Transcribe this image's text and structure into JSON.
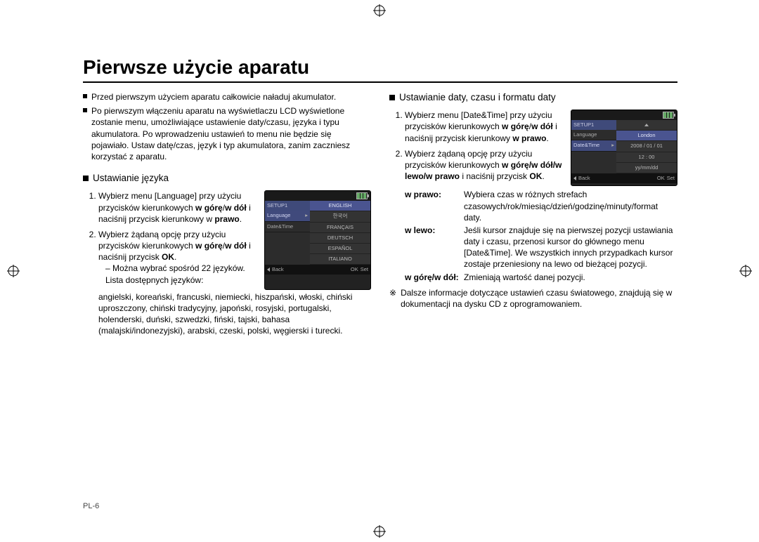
{
  "page_number": "PL-6",
  "title": "Pierwsze użycie aparatu",
  "intro_bullets": [
    "Przed pierwszym użyciem aparatu całkowicie naładuj akumulator.",
    "Po pierwszym włączeniu aparatu na wyświetlaczu LCD wyświetlone zostanie menu, umożliwiające ustawienie daty/czasu, języka i typu akumulatora. Po wprowadzeniu ustawień to menu nie będzie się pojawiało. Ustaw datę/czas, język i typ akumulatora, zanim zaczniesz korzystać z aparatu."
  ],
  "section_language": {
    "heading": "Ustawianie języka",
    "steps": [
      {
        "pre": "Wybierz menu [Language] przy użyciu przycisków kierunkowych ",
        "bold1": "w górę",
        "mid": "/",
        "bold2": "w dół",
        "post": " i naciśnij przycisk kierunkowy w ",
        "bold3": "prawo",
        "end": "."
      },
      {
        "pre": "Wybierz żądaną opcję przy użyciu przycisków kierunkowych ",
        "bold1": "w górę",
        "mid": "/",
        "bold2": "w dół",
        "post": " i naciśnij przycisk ",
        "bold3": "OK",
        "end": "."
      }
    ],
    "sub_dash": "Można wybrać spośród 22 języków. Lista dostępnych języków:",
    "lang_list": "angielski, koreański, francuski, niemiecki, hiszpański, włoski, chiński uproszczony, chiński tradycyjny, japoński, rosyjski, portugalski, holenderski, duński, szwedzki, fiński, tajski, bahasa (malajski/indonezyjski), arabski, czeski, polski, węgierski i turecki.",
    "lcd": {
      "menu_title": "SETUP1",
      "menu_rows": [
        "Language",
        "Date&Time"
      ],
      "list_rows": [
        "ENGLISH",
        "한국어",
        "FRANÇAIS",
        "DEUTSCH",
        "ESPAÑOL",
        "ITALIANO"
      ],
      "back": "Back",
      "ok": "OK",
      "set": "Set"
    }
  },
  "section_datetime": {
    "heading": "Ustawianie daty, czasu i formatu daty",
    "steps": [
      {
        "pre": "Wybierz menu [Date&Time] przy użyciu przycisków kierunkowych ",
        "bold1": "w górę",
        "mid": "/",
        "bold2": "w dół",
        "post": " i naciśnij przycisk kierunkowy ",
        "bold3": "w prawo",
        "end": "."
      },
      {
        "pre": "Wybierz żądaną opcję przy użyciu przycisków kierunkowych ",
        "bold_seq": "w górę/w dół/w lewo/w prawo",
        "post": " i naciśnij przycisk ",
        "bold3": "OK",
        "end": "."
      }
    ],
    "defs": [
      {
        "label": "w prawo",
        "text": "Wybiera czas w różnych strefach czasowych/rok/miesiąc/dzień/godzinę/minuty/format daty."
      },
      {
        "label": "w lewo",
        "text": "Jeśli kursor znajduje się na pierwszej pozycji ustawiania daty i czasu, przenosi kursor do głównego menu [Date&Time]. We wszystkich innych przypadkach kursor zostaje przeniesiony na lewo od bieżącej pozycji."
      },
      {
        "label": "w górę/w dół",
        "text": "Zmieniają wartość danej pozycji."
      }
    ],
    "note_mark": "※",
    "note": "Dalsze informacje dotyczące ustawień czasu światowego, znajdują się w dokumentacji na dysku CD z oprogramowaniem.",
    "lcd": {
      "menu_title": "SETUP1",
      "menu_rows": [
        "Language",
        "Date&Time"
      ],
      "right_rows": [
        "London",
        "2008 / 01 / 01",
        "12 : 00",
        "yy/mm/dd"
      ],
      "back": "Back",
      "ok": "OK",
      "set": "Set"
    }
  }
}
